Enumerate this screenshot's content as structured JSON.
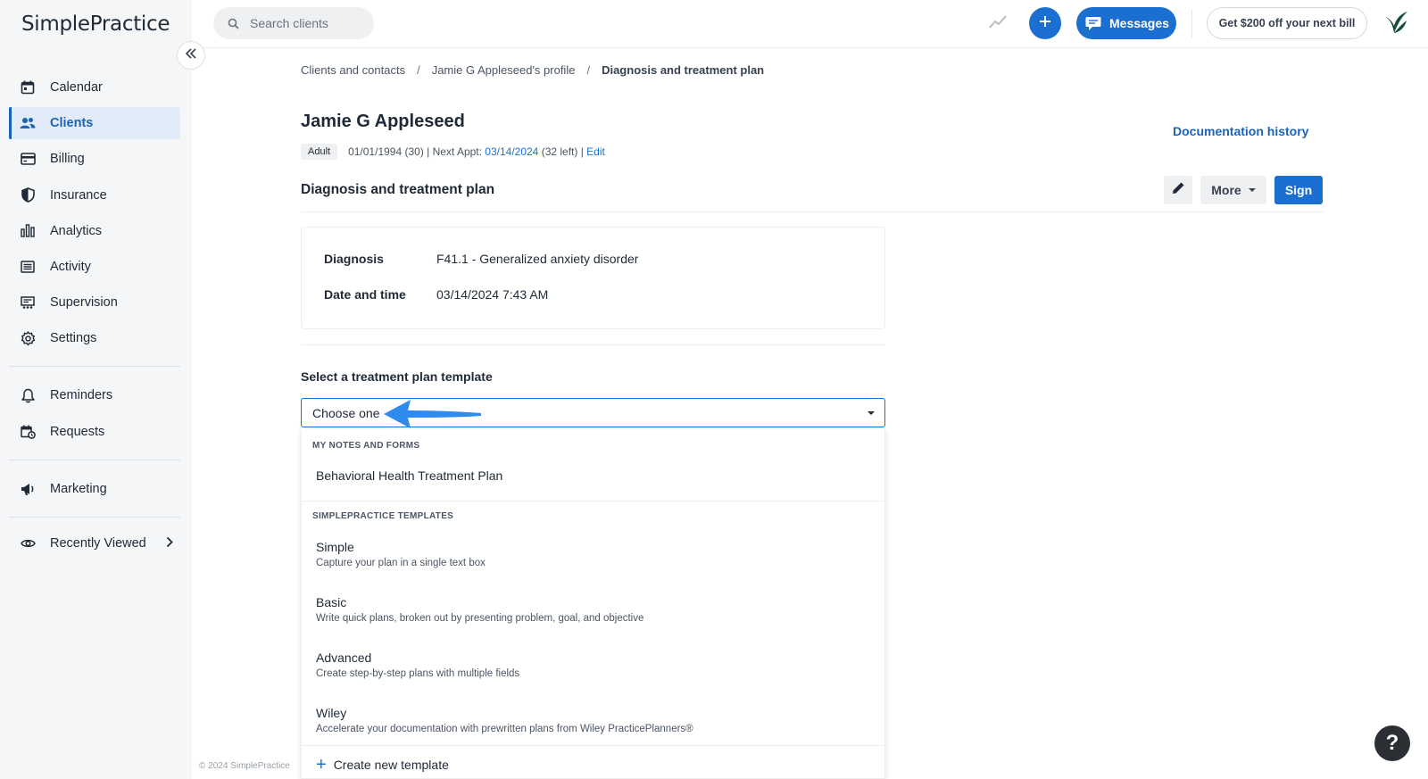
{
  "app": {
    "logo_text": "SimplePractice",
    "copyright": "© 2024 SimplePractice"
  },
  "sidebar": {
    "items": [
      {
        "label": "Calendar",
        "icon": "calendar-icon"
      },
      {
        "label": "Clients",
        "icon": "people-icon",
        "active": true
      },
      {
        "label": "Billing",
        "icon": "credit-card-icon"
      },
      {
        "label": "Insurance",
        "icon": "shield-icon"
      },
      {
        "label": "Analytics",
        "icon": "bar-chart-icon"
      },
      {
        "label": "Activity",
        "icon": "list-icon"
      },
      {
        "label": "Supervision",
        "icon": "supervision-icon"
      },
      {
        "label": "Settings",
        "icon": "gear-icon"
      }
    ],
    "secondary": [
      {
        "label": "Reminders",
        "icon": "bell-icon"
      },
      {
        "label": "Requests",
        "icon": "calendar-request-icon"
      }
    ],
    "marketing": {
      "label": "Marketing",
      "icon": "megaphone-icon"
    },
    "recent": {
      "label": "Recently Viewed",
      "icon": "eye-icon"
    }
  },
  "topbar": {
    "search_placeholder": "Search clients",
    "messages_label": "Messages",
    "promo_label": "Get $200 off your next bill"
  },
  "breadcrumb": {
    "items": [
      "Clients and contacts",
      "Jamie G Appleseed's profile"
    ],
    "current": "Diagnosis and treatment plan",
    "separator": "/"
  },
  "client": {
    "name": "Jamie G Appleseed",
    "badge": "Adult",
    "dob": "01/01/1994 (30) | Next Appt: ",
    "next_appt": "03/14/2024",
    "left": " (32 left) | ",
    "edit": "Edit"
  },
  "header": {
    "documentation_history": "Documentation history",
    "section_title": "Diagnosis and treatment plan",
    "more_label": "More",
    "sign_label": "Sign"
  },
  "diagnosis": {
    "rows": [
      {
        "key": "Diagnosis",
        "value": "F41.1 - Generalized anxiety disorder"
      },
      {
        "key": "Date and time",
        "value": "03/14/2024 7:43 AM"
      }
    ]
  },
  "template_select": {
    "label": "Select a treatment plan template",
    "value": "Choose one",
    "groups": [
      {
        "title": "MY NOTES AND FORMS",
        "items": [
          {
            "name": "Behavioral Health Treatment Plan",
            "desc": ""
          }
        ]
      },
      {
        "title": "SIMPLEPRACTICE TEMPLATES",
        "items": [
          {
            "name": "Simple",
            "desc": "Capture your plan in a single text box"
          },
          {
            "name": "Basic",
            "desc": "Write quick plans, broken out by presenting problem, goal, and objective"
          },
          {
            "name": "Advanced",
            "desc": "Create step-by-step plans with multiple fields"
          },
          {
            "name": "Wiley",
            "desc": "Accelerate your documentation with prewritten plans from Wiley PracticePlanners®"
          }
        ]
      }
    ],
    "create_label": "Create new template"
  },
  "help": {
    "label": "?"
  },
  "colors": {
    "primary": "#1a6fd1",
    "sidebar_bg": "#f5f6f7",
    "active_bg": "#e1ecf8",
    "annotation_arrow": "#2f8bef"
  }
}
